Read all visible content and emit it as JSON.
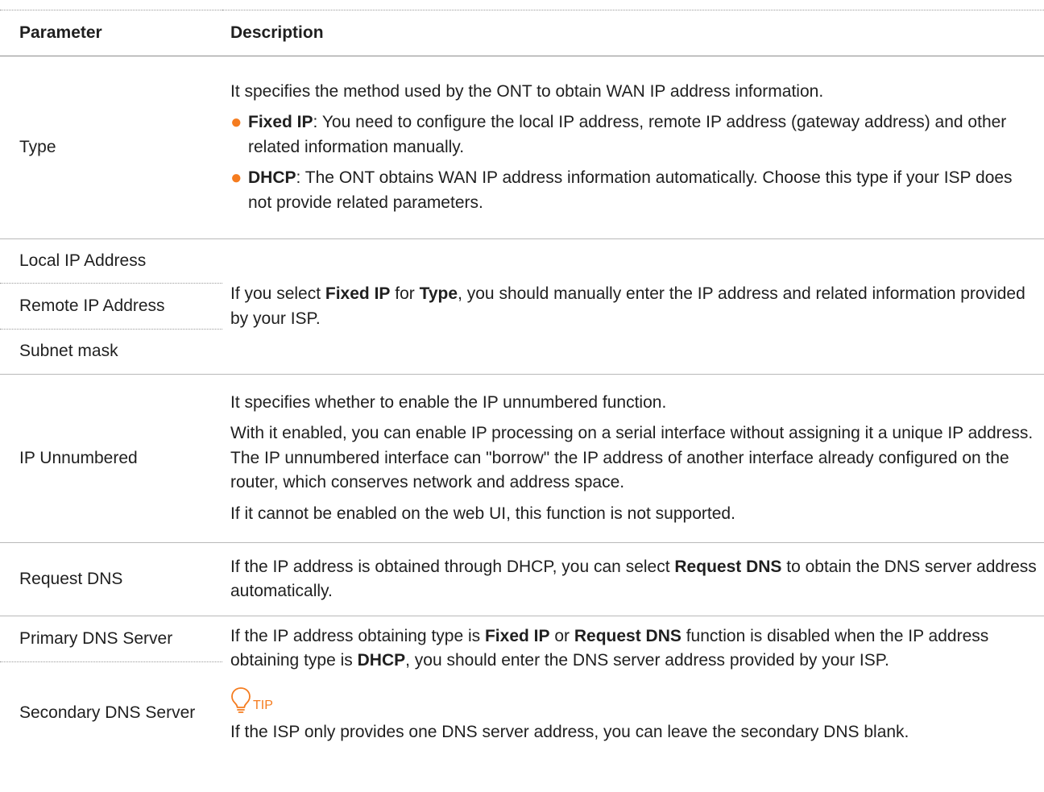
{
  "table": {
    "header": {
      "parameter": "Parameter",
      "description": "Description"
    },
    "type": {
      "param": "Type",
      "intro": "It specifies the method used by the ONT to obtain WAN IP address information.",
      "bullets": [
        {
          "term": "Fixed IP",
          "text": ": You need to configure the local IP address, remote IP address (gateway address) and other related information manually."
        },
        {
          "term": "DHCP",
          "text": ": The ONT obtains WAN IP address information automatically. Choose this type if your ISP does not provide related parameters."
        }
      ]
    },
    "ip_group": {
      "params": [
        "Local IP Address",
        "Remote IP Address",
        "Subnet mask"
      ],
      "desc_pre": "If you select ",
      "desc_term1": "Fixed IP",
      "desc_mid": " for ",
      "desc_term2": "Type",
      "desc_post": ", you should manually enter the IP address and related information provided by your ISP."
    },
    "ip_unnumbered": {
      "param": "IP Unnumbered",
      "p1": "It specifies whether to enable the IP unnumbered function.",
      "p2": "With it enabled, you can enable IP processing on a serial interface without assigning it a unique IP address. The IP unnumbered interface can \"borrow\" the IP address of another interface already configured on the router, which conserves network and address space.",
      "p3": "If it cannot be enabled on the web UI, this function is not supported."
    },
    "request_dns": {
      "param": "Request DNS",
      "desc_pre": "If the IP address is obtained through DHCP, you can select ",
      "desc_term": "Request DNS",
      "desc_post": " to obtain the DNS server address automatically."
    },
    "dns_servers": {
      "params": [
        "Primary DNS Server",
        "Secondary DNS Server"
      ],
      "desc_a": "If the IP address obtaining type is ",
      "desc_term1": "Fixed IP",
      "desc_b": " or ",
      "desc_term2": "Request DNS",
      "desc_c": " function is disabled when the IP address obtaining type is ",
      "desc_term3": "DHCP",
      "desc_d": ", you should enter the DNS server address provided by your ISP.",
      "tip_label": "TIP",
      "tip_text": "If the ISP only provides one DNS server address, you can leave the secondary DNS blank."
    }
  },
  "colors": {
    "accent": "#f57c1f",
    "text": "#1f1f1f",
    "rule": "#9a9a9a"
  },
  "icons": {
    "tip": "lightbulb-icon",
    "bullet": "orange-dot"
  }
}
